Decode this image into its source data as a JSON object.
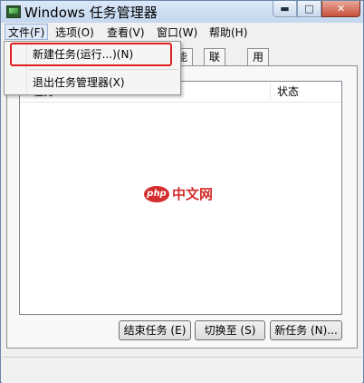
{
  "window": {
    "title": "Windows 任务管理器",
    "controls": {
      "minimize": "▬",
      "maximize": "□",
      "close": "✕"
    }
  },
  "menubar": {
    "items": [
      {
        "label": "文件(F)"
      },
      {
        "label": "选项(O)"
      },
      {
        "label": "查看(V)"
      },
      {
        "label": "窗口(W)"
      },
      {
        "label": "帮助(H)"
      }
    ]
  },
  "file_menu": {
    "items": [
      {
        "label": "新建任务(运行...)(N)"
      },
      {
        "label": "退出任务管理器(X)"
      }
    ]
  },
  "tabs": [
    {
      "label": "能"
    },
    {
      "label": "联网"
    },
    {
      "label": "用户"
    }
  ],
  "list": {
    "columns": [
      {
        "label": "任务"
      },
      {
        "label": "状态"
      }
    ]
  },
  "watermark": {
    "logo": "php",
    "text": "中文网"
  },
  "buttons": {
    "end_task": "结束任务 (E)",
    "switch_to": "切换至 (S)",
    "new_task": "新任务 (N)..."
  },
  "colors": {
    "highlight_border": "#e02020",
    "watermark": "#d32d2d"
  }
}
